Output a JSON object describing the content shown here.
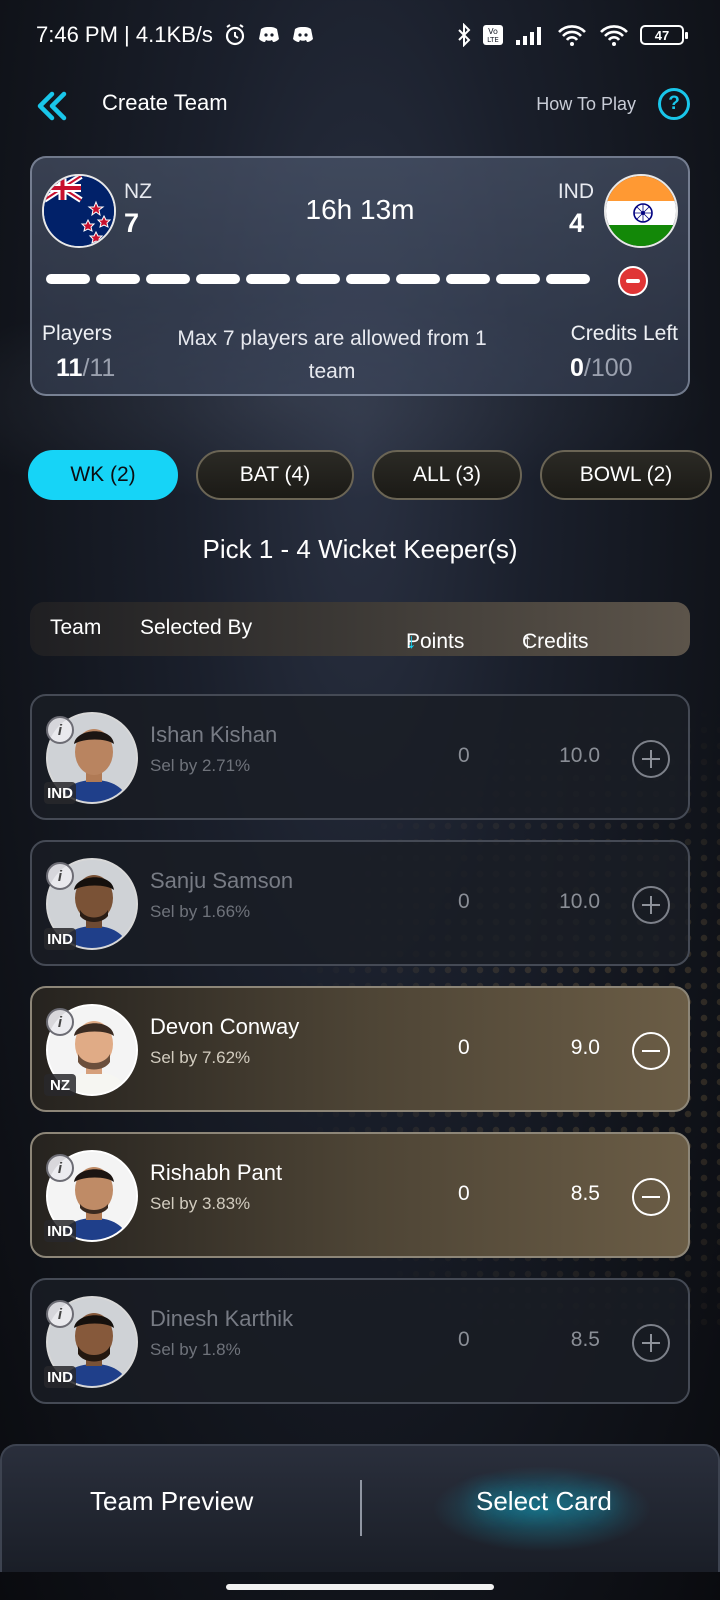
{
  "status_bar": {
    "time_speed": "7:46 PM | 4.1KB/s",
    "battery": "47"
  },
  "header": {
    "title": "Create Team",
    "how_to_play": "How To Play",
    "help_glyph": "?"
  },
  "match": {
    "team1": {
      "name": "NZ",
      "count": "7"
    },
    "team2": {
      "name": "IND",
      "count": "4"
    },
    "time_left": "16h 13m",
    "players_label": "Players",
    "players_selected": "11",
    "players_total": "/11",
    "max_note": "Max 7 players are allowed from 1 team",
    "credits_label": "Credits Left",
    "credits_left": "0",
    "credits_total": "/100"
  },
  "tabs": [
    {
      "label": "WK (2)",
      "active": true
    },
    {
      "label": "BAT (4)",
      "active": false
    },
    {
      "label": "ALL (3)",
      "active": false
    },
    {
      "label": "BOWL (2)",
      "active": false
    }
  ],
  "pick_heading": "Pick 1 - 4 Wicket Keeper(s)",
  "sort_bar": {
    "team": "Team",
    "selected_by": "Selected By",
    "points": "Points",
    "points_arrow": "↓",
    "credits": "Credits",
    "credits_arrow": "↑"
  },
  "players": [
    {
      "name": "Ishan Kishan",
      "sel": "Sel by 2.71%",
      "team": "IND",
      "points": "0",
      "credits": "10.0",
      "selected": false
    },
    {
      "name": "Sanju Samson",
      "sel": "Sel by 1.66%",
      "team": "IND",
      "points": "0",
      "credits": "10.0",
      "selected": false
    },
    {
      "name": "Devon Conway",
      "sel": "Sel by 7.62%",
      "team": "NZ",
      "points": "0",
      "credits": "9.0",
      "selected": true
    },
    {
      "name": "Rishabh Pant",
      "sel": "Sel by 3.83%",
      "team": "IND",
      "points": "0",
      "credits": "8.5",
      "selected": true
    },
    {
      "name": "Dinesh Karthik",
      "sel": "Sel by 1.8%",
      "team": "IND",
      "points": "0",
      "credits": "8.5",
      "selected": false
    }
  ],
  "info_glyph": "i",
  "bottom": {
    "team_preview": "Team Preview",
    "select_card": "Select Card"
  },
  "colors": {
    "accent": "#16d4f7",
    "clear": "#e03535"
  }
}
